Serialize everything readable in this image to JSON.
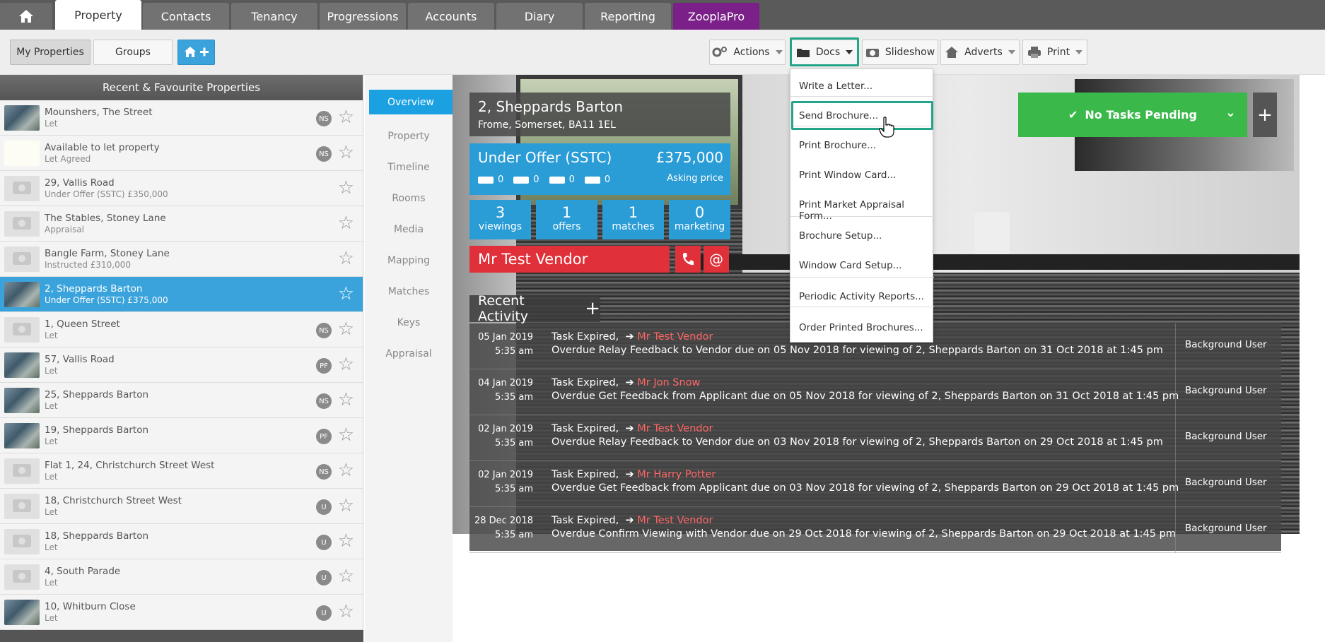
{
  "top_tabs": [
    "Property",
    "Contacts",
    "Tenancy",
    "Progressions",
    "Accounts",
    "Diary",
    "Reporting",
    "ZooplaPro"
  ],
  "toolbar": {
    "my_properties": "My Properties",
    "groups": "Groups",
    "actions": "Actions",
    "docs": "Docs",
    "slideshow": "Slideshow",
    "adverts": "Adverts",
    "print": "Print"
  },
  "left_panel": {
    "title": "Recent & Favourite Properties",
    "items": [
      {
        "title": "Mounshers, The Street",
        "sub": "Let",
        "badge": "NS"
      },
      {
        "title": "Available to let property",
        "sub": "Let Agreed",
        "badge": "NS"
      },
      {
        "title": "29, Vallis Road",
        "sub": "Under Offer (SSTC) £350,000",
        "badge": ""
      },
      {
        "title": "The Stables, Stoney Lane",
        "sub": "Appraisal",
        "badge": ""
      },
      {
        "title": "Bangle Farm, Stoney Lane",
        "sub": "Instructed £310,000",
        "badge": ""
      },
      {
        "title": "2, Sheppards Barton",
        "sub": "Under Offer (SSTC) £375,000",
        "badge": ""
      },
      {
        "title": "1, Queen Street",
        "sub": "Let",
        "badge": "NS"
      },
      {
        "title": "57, Vallis Road",
        "sub": "Let",
        "badge": "PF"
      },
      {
        "title": "25, Sheppards Barton",
        "sub": "Let",
        "badge": "NS"
      },
      {
        "title": "19, Sheppards Barton",
        "sub": "Let",
        "badge": "PF"
      },
      {
        "title": "Flat 1, 24, Christchurch Street West",
        "sub": "Let",
        "badge": "NS"
      },
      {
        "title": "18, Christchurch Street West",
        "sub": "Let",
        "badge": "U"
      },
      {
        "title": "18, Sheppards Barton",
        "sub": "Let",
        "badge": "U"
      },
      {
        "title": "4, South Parade",
        "sub": "Let",
        "badge": "U"
      },
      {
        "title": "10, Whitburn Close",
        "sub": "Let",
        "badge": "U"
      }
    ]
  },
  "side_nav": [
    "Overview",
    "Property",
    "Timeline",
    "Rooms",
    "Media",
    "Mapping",
    "Matches",
    "Keys",
    "Appraisal"
  ],
  "property": {
    "address_line1": "2, Sheppards Barton",
    "address_line2": "Frome, Somerset, BA11 1EL",
    "status": "Under Offer (SSTC)",
    "price": "£375,000",
    "price_label": "Asking price",
    "features": [
      "0",
      "0",
      "0",
      "0"
    ],
    "stats": [
      {
        "num": "3",
        "label": "viewings"
      },
      {
        "num": "1",
        "label": "offers"
      },
      {
        "num": "1",
        "label": "matches"
      },
      {
        "num": "0",
        "label": "marketing"
      }
    ],
    "vendor": "Mr Test Vendor"
  },
  "tasks": {
    "label": "No Tasks Pending"
  },
  "recent_activity": {
    "title": "Recent Activity",
    "rows": [
      {
        "date": "05 Jan 2019",
        "time": "5:35 am",
        "kind": "Task Expired,",
        "who": "Mr Test Vendor",
        "desc": "Overdue Relay Feedback to Vendor due on 05 Nov 2018 for viewing of 2, Sheppards Barton on 31 Oct 2018 at 1:45 pm",
        "user": "Background User"
      },
      {
        "date": "04 Jan 2019",
        "time": "5:35 am",
        "kind": "Task Expired,",
        "who": "Mr Jon Snow",
        "desc": "Overdue Get Feedback from Applicant due on 05 Nov 2018 for viewing of 2, Sheppards Barton on 31 Oct 2018 at 1:45 pm",
        "user": "Background User"
      },
      {
        "date": "02 Jan 2019",
        "time": "5:35 am",
        "kind": "Task Expired,",
        "who": "Mr Test Vendor",
        "desc": "Overdue Relay Feedback to Vendor due on 03 Nov 2018 for viewing of 2, Sheppards Barton on 29 Oct 2018 at 1:45 pm",
        "user": "Background User"
      },
      {
        "date": "02 Jan 2019",
        "time": "5:35 am",
        "kind": "Task Expired,",
        "who": "Mr Harry Potter",
        "desc": "Overdue Get Feedback from Applicant due on 03 Nov 2018 for viewing of 2, Sheppards Barton on 29 Oct 2018 at 1:45 pm",
        "user": "Background User"
      },
      {
        "date": "28 Dec 2018",
        "time": "5:35 am",
        "kind": "Task Expired,",
        "who": "Mr Test Vendor",
        "desc": "Overdue Confirm Viewing with Vendor due on 29 Oct 2018 for viewing of 2, Sheppards Barton on 29 Oct 2018 at 1:45 pm",
        "user": "Background User"
      }
    ]
  },
  "docs_menu": [
    "Write a Letter...",
    "Send Brochure...",
    "Print Brochure...",
    "Print Window Card...",
    "Print Market Appraisal Form...",
    "Brochure Setup...",
    "Window Card Setup...",
    "Periodic Activity Reports...",
    "Order Printed Brochures..."
  ],
  "colors": {
    "accent_blue": "#2a9cd6",
    "zoopla_purple": "#7a2088",
    "vendor_red": "#e0303a",
    "tasks_green": "#3bb84a",
    "highlight_teal": "#24a58a"
  }
}
